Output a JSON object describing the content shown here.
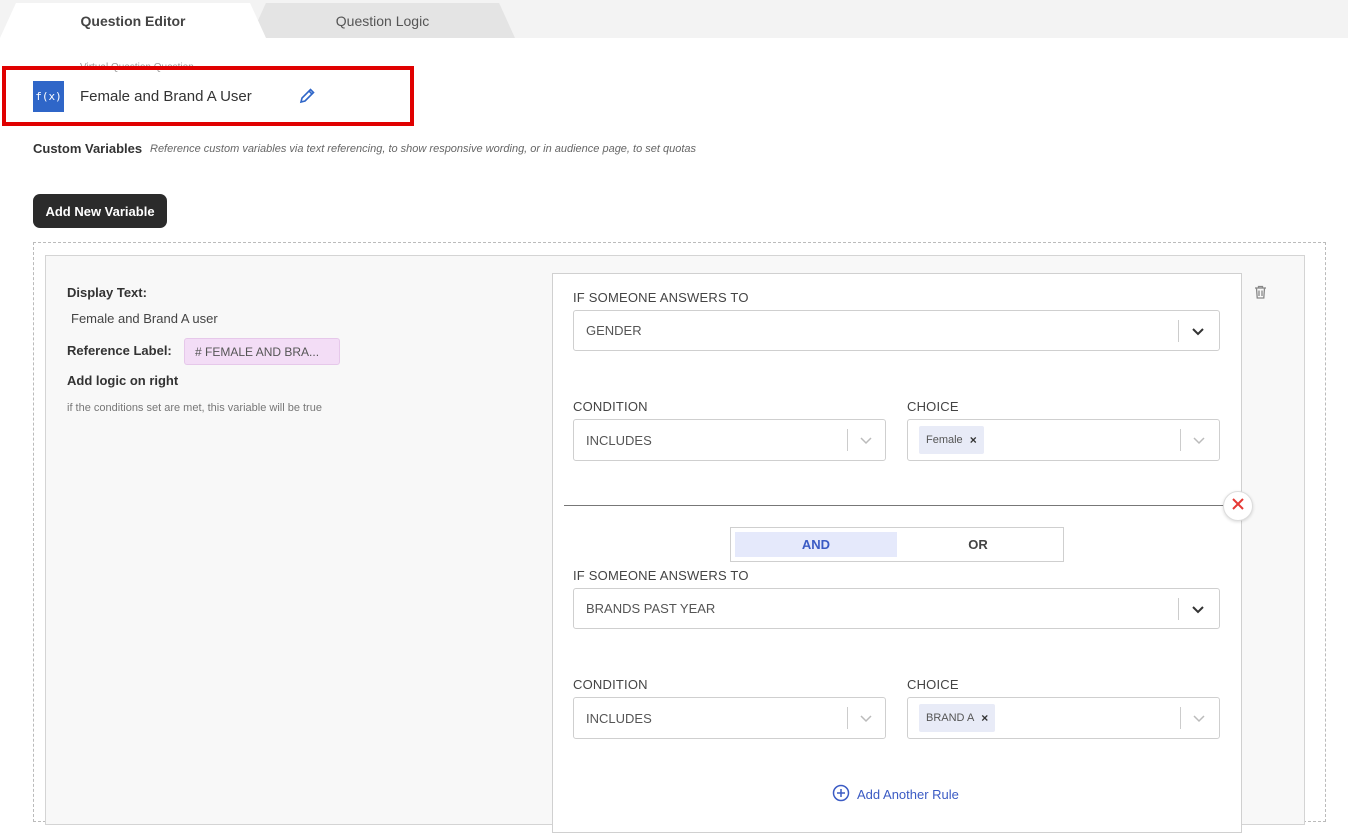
{
  "tabs": [
    {
      "label": "Question Editor",
      "active": true
    },
    {
      "label": "Question Logic",
      "active": false
    }
  ],
  "virtual_question": {
    "small_label": "Virtual Question Question",
    "icon_text": "f(x)",
    "title": "Female and Brand A User"
  },
  "custom_variables": {
    "title": "Custom Variables",
    "hint": "Reference custom variables via text referencing, to show responsive wording, or in audience page, to set quotas",
    "add_button": "Add New Variable"
  },
  "variable": {
    "display_text_label": "Display Text:",
    "display_text_value": "Female and Brand A user",
    "reference_label": "Reference Label:",
    "reference_value": "#  FEMALE AND BRA...",
    "logic_heading": "Add logic on right",
    "logic_hint": "if the conditions set are met, this variable will be true"
  },
  "rules": [
    {
      "question_label": "IF SOMEONE ANSWERS TO",
      "question_value": "GENDER",
      "condition_label": "CONDITION",
      "condition_value": "INCLUDES",
      "choice_label": "CHOICE",
      "choice_chip": "Female"
    },
    {
      "question_label": "IF SOMEONE ANSWERS TO",
      "question_value": "BRANDS PAST YEAR",
      "condition_label": "CONDITION",
      "condition_value": "INCLUDES",
      "choice_label": "CHOICE",
      "choice_chip": "BRAND A"
    }
  ],
  "operator": {
    "and_label": "AND",
    "or_label": "OR",
    "selected": "AND"
  },
  "add_rule_label": "Add Another Rule",
  "colors": {
    "accent": "#2f66c8",
    "highlight": "#e00000",
    "danger": "#e53935"
  }
}
